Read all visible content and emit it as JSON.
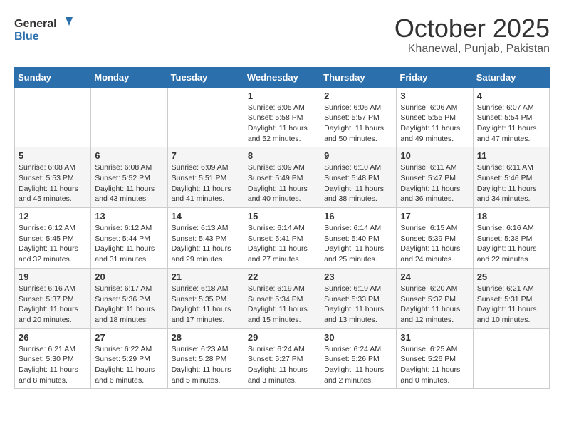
{
  "header": {
    "logo_general": "General",
    "logo_blue": "Blue",
    "month_year": "October 2025",
    "location": "Khanewal, Punjab, Pakistan"
  },
  "weekdays": [
    "Sunday",
    "Monday",
    "Tuesday",
    "Wednesday",
    "Thursday",
    "Friday",
    "Saturday"
  ],
  "weeks": [
    [
      {
        "day": "",
        "info": ""
      },
      {
        "day": "",
        "info": ""
      },
      {
        "day": "",
        "info": ""
      },
      {
        "day": "1",
        "info": "Sunrise: 6:05 AM\nSunset: 5:58 PM\nDaylight: 11 hours and 52 minutes."
      },
      {
        "day": "2",
        "info": "Sunrise: 6:06 AM\nSunset: 5:57 PM\nDaylight: 11 hours and 50 minutes."
      },
      {
        "day": "3",
        "info": "Sunrise: 6:06 AM\nSunset: 5:55 PM\nDaylight: 11 hours and 49 minutes."
      },
      {
        "day": "4",
        "info": "Sunrise: 6:07 AM\nSunset: 5:54 PM\nDaylight: 11 hours and 47 minutes."
      }
    ],
    [
      {
        "day": "5",
        "info": "Sunrise: 6:08 AM\nSunset: 5:53 PM\nDaylight: 11 hours and 45 minutes."
      },
      {
        "day": "6",
        "info": "Sunrise: 6:08 AM\nSunset: 5:52 PM\nDaylight: 11 hours and 43 minutes."
      },
      {
        "day": "7",
        "info": "Sunrise: 6:09 AM\nSunset: 5:51 PM\nDaylight: 11 hours and 41 minutes."
      },
      {
        "day": "8",
        "info": "Sunrise: 6:09 AM\nSunset: 5:49 PM\nDaylight: 11 hours and 40 minutes."
      },
      {
        "day": "9",
        "info": "Sunrise: 6:10 AM\nSunset: 5:48 PM\nDaylight: 11 hours and 38 minutes."
      },
      {
        "day": "10",
        "info": "Sunrise: 6:11 AM\nSunset: 5:47 PM\nDaylight: 11 hours and 36 minutes."
      },
      {
        "day": "11",
        "info": "Sunrise: 6:11 AM\nSunset: 5:46 PM\nDaylight: 11 hours and 34 minutes."
      }
    ],
    [
      {
        "day": "12",
        "info": "Sunrise: 6:12 AM\nSunset: 5:45 PM\nDaylight: 11 hours and 32 minutes."
      },
      {
        "day": "13",
        "info": "Sunrise: 6:12 AM\nSunset: 5:44 PM\nDaylight: 11 hours and 31 minutes."
      },
      {
        "day": "14",
        "info": "Sunrise: 6:13 AM\nSunset: 5:43 PM\nDaylight: 11 hours and 29 minutes."
      },
      {
        "day": "15",
        "info": "Sunrise: 6:14 AM\nSunset: 5:41 PM\nDaylight: 11 hours and 27 minutes."
      },
      {
        "day": "16",
        "info": "Sunrise: 6:14 AM\nSunset: 5:40 PM\nDaylight: 11 hours and 25 minutes."
      },
      {
        "day": "17",
        "info": "Sunrise: 6:15 AM\nSunset: 5:39 PM\nDaylight: 11 hours and 24 minutes."
      },
      {
        "day": "18",
        "info": "Sunrise: 6:16 AM\nSunset: 5:38 PM\nDaylight: 11 hours and 22 minutes."
      }
    ],
    [
      {
        "day": "19",
        "info": "Sunrise: 6:16 AM\nSunset: 5:37 PM\nDaylight: 11 hours and 20 minutes."
      },
      {
        "day": "20",
        "info": "Sunrise: 6:17 AM\nSunset: 5:36 PM\nDaylight: 11 hours and 18 minutes."
      },
      {
        "day": "21",
        "info": "Sunrise: 6:18 AM\nSunset: 5:35 PM\nDaylight: 11 hours and 17 minutes."
      },
      {
        "day": "22",
        "info": "Sunrise: 6:19 AM\nSunset: 5:34 PM\nDaylight: 11 hours and 15 minutes."
      },
      {
        "day": "23",
        "info": "Sunrise: 6:19 AM\nSunset: 5:33 PM\nDaylight: 11 hours and 13 minutes."
      },
      {
        "day": "24",
        "info": "Sunrise: 6:20 AM\nSunset: 5:32 PM\nDaylight: 11 hours and 12 minutes."
      },
      {
        "day": "25",
        "info": "Sunrise: 6:21 AM\nSunset: 5:31 PM\nDaylight: 11 hours and 10 minutes."
      }
    ],
    [
      {
        "day": "26",
        "info": "Sunrise: 6:21 AM\nSunset: 5:30 PM\nDaylight: 11 hours and 8 minutes."
      },
      {
        "day": "27",
        "info": "Sunrise: 6:22 AM\nSunset: 5:29 PM\nDaylight: 11 hours and 6 minutes."
      },
      {
        "day": "28",
        "info": "Sunrise: 6:23 AM\nSunset: 5:28 PM\nDaylight: 11 hours and 5 minutes."
      },
      {
        "day": "29",
        "info": "Sunrise: 6:24 AM\nSunset: 5:27 PM\nDaylight: 11 hours and 3 minutes."
      },
      {
        "day": "30",
        "info": "Sunrise: 6:24 AM\nSunset: 5:26 PM\nDaylight: 11 hours and 2 minutes."
      },
      {
        "day": "31",
        "info": "Sunrise: 6:25 AM\nSunset: 5:26 PM\nDaylight: 11 hours and 0 minutes."
      },
      {
        "day": "",
        "info": ""
      }
    ]
  ]
}
